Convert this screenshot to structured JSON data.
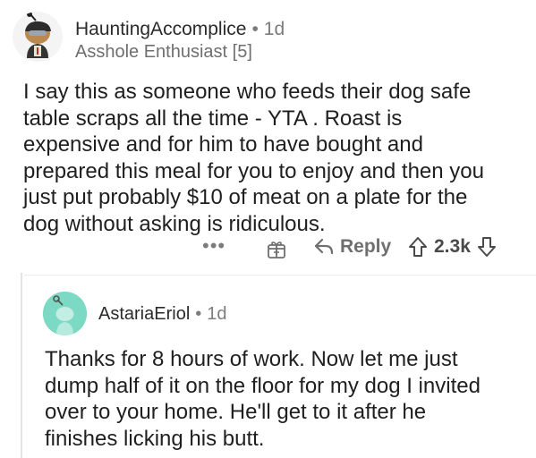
{
  "comment": {
    "username": "HauntingAccomplice",
    "age": "1d",
    "flair": "Asshole Enthusiast [5]",
    "body": "I say this as someone who feeds their dog safe\ntable scraps all the time - YTA . Roast is\nexpensive and for him to have bought and\nprepared this meal for you to enjoy and then you\njust put probably $10 of meat on a plate for the\ndog without asking is ridiculous.",
    "actions": {
      "more": "•••",
      "reply_label": "Reply",
      "score": "2.3k"
    }
  },
  "reply": {
    "username": "AstariaEriol",
    "age": "1d",
    "body": "Thanks for 8 hours of work. Now let me just\ndump half of it on the floor for my dog I invited\nover to your home. He'll get to it after he\nfinishes licking his butt."
  },
  "colors": {
    "avatar_reply_bg": "#7bd9c4",
    "meta_gray": "#7c7c7c",
    "text": "#1f1f1f"
  },
  "separator": "•"
}
